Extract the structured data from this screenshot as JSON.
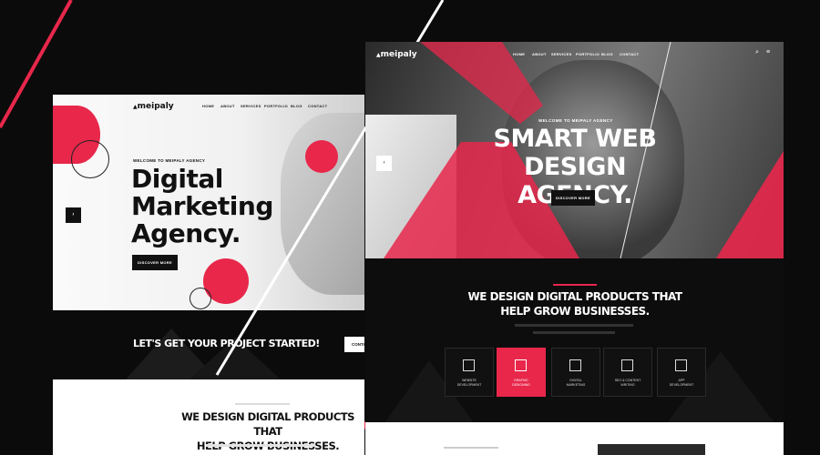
{
  "colors": {
    "accent": "#e8274b",
    "dark": "#0b0b0b",
    "white": "#ffffff"
  },
  "left": {
    "logo": "meipaly",
    "nav": [
      "HOME",
      "ABOUT",
      "SERVICES",
      "PORTFOLIO",
      "BLOG",
      "CONTACT"
    ],
    "welcome": "WELCOME TO MEIPALY AGENCY",
    "headline_1": "Digital",
    "headline_2": "Marketing",
    "headline_3": "Agency.",
    "discover": "DISCOVER MORE",
    "cta_text": "LET'S GET YOUR PROJECT STARTED!",
    "cta_button": "CONTA",
    "lower_heading_1": "WE DESIGN DIGITAL PRODUCTS THAT",
    "lower_heading_2": "HELP GROW BUSINESSES."
  },
  "right": {
    "logo": "meipaly",
    "nav": [
      "HOME",
      "ABOUT",
      "SERVICES",
      "PORTFOLIO",
      "BLOG",
      "CONTACT"
    ],
    "welcome": "WELCOME TO MEIPALY AGENCY",
    "headline_1": "SMART WEB",
    "headline_2": "DESIGN AGENCY.",
    "discover": "DISCOVER MORE",
    "section_heading_1": "WE DESIGN DIGITAL PRODUCTS THAT",
    "section_heading_2": "HELP GROW BUSINESSES.",
    "services": [
      {
        "line1": "WEBSITE",
        "line2": "DEVELOPMENT",
        "icon": "monitor-code-icon"
      },
      {
        "line1": "GRAPHIC",
        "line2": "DESIGNING",
        "icon": "monitor-design-icon"
      },
      {
        "line1": "DIGITAL",
        "line2": "MARKETING",
        "icon": "marketing-icon"
      },
      {
        "line1": "SEO & CONTENT",
        "line2": "WRITING",
        "icon": "seo-icon"
      },
      {
        "line1": "APP",
        "line2": "DEVELOPMENT",
        "icon": "app-icon"
      }
    ]
  }
}
